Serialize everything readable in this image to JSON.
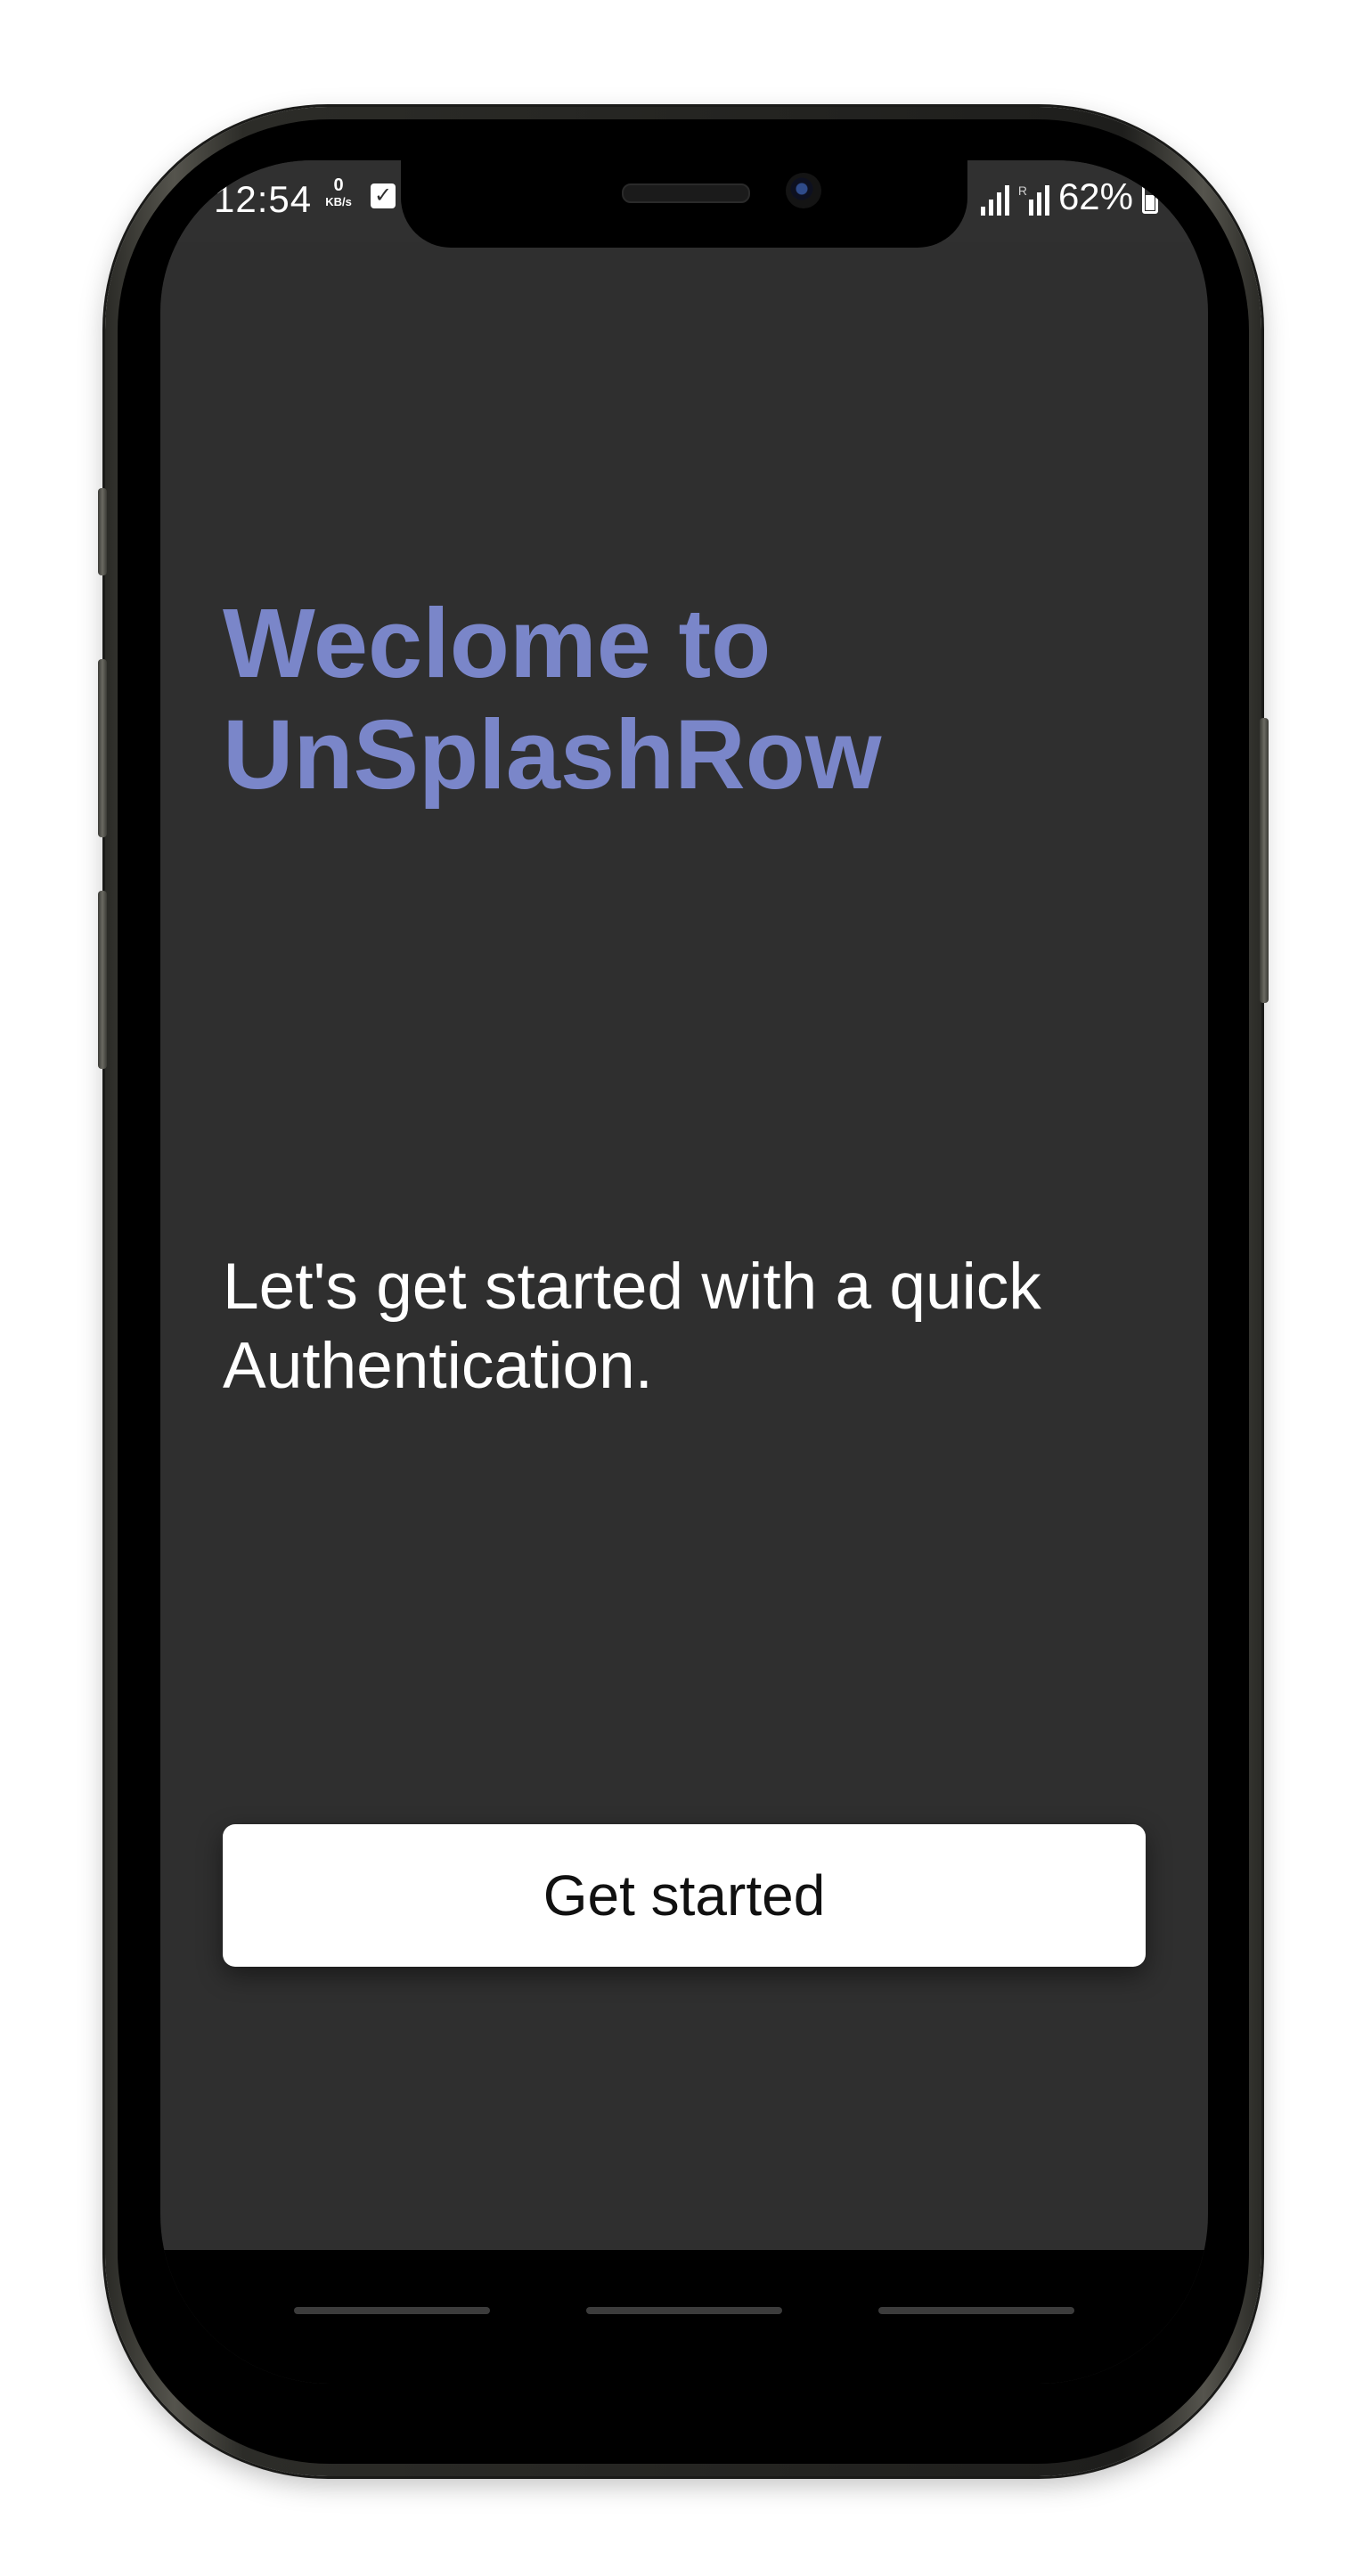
{
  "status_bar": {
    "time": "12:54",
    "net_speed_value": "0",
    "net_speed_unit": "KB/s",
    "sim2_label": "R",
    "battery_percent": "62%"
  },
  "welcome": {
    "title_line1": "Weclome to",
    "title_line2": "UnSplashRow",
    "subtitle": "Let's get started with a quick Authentication."
  },
  "actions": {
    "get_started_label": "Get started"
  },
  "colors": {
    "title": "#7a86c9",
    "background": "#2f2f2f",
    "button": "#ffffff"
  },
  "icons": [
    "check-box-icon",
    "signal-icon",
    "battery-icon",
    "camera-icon"
  ]
}
